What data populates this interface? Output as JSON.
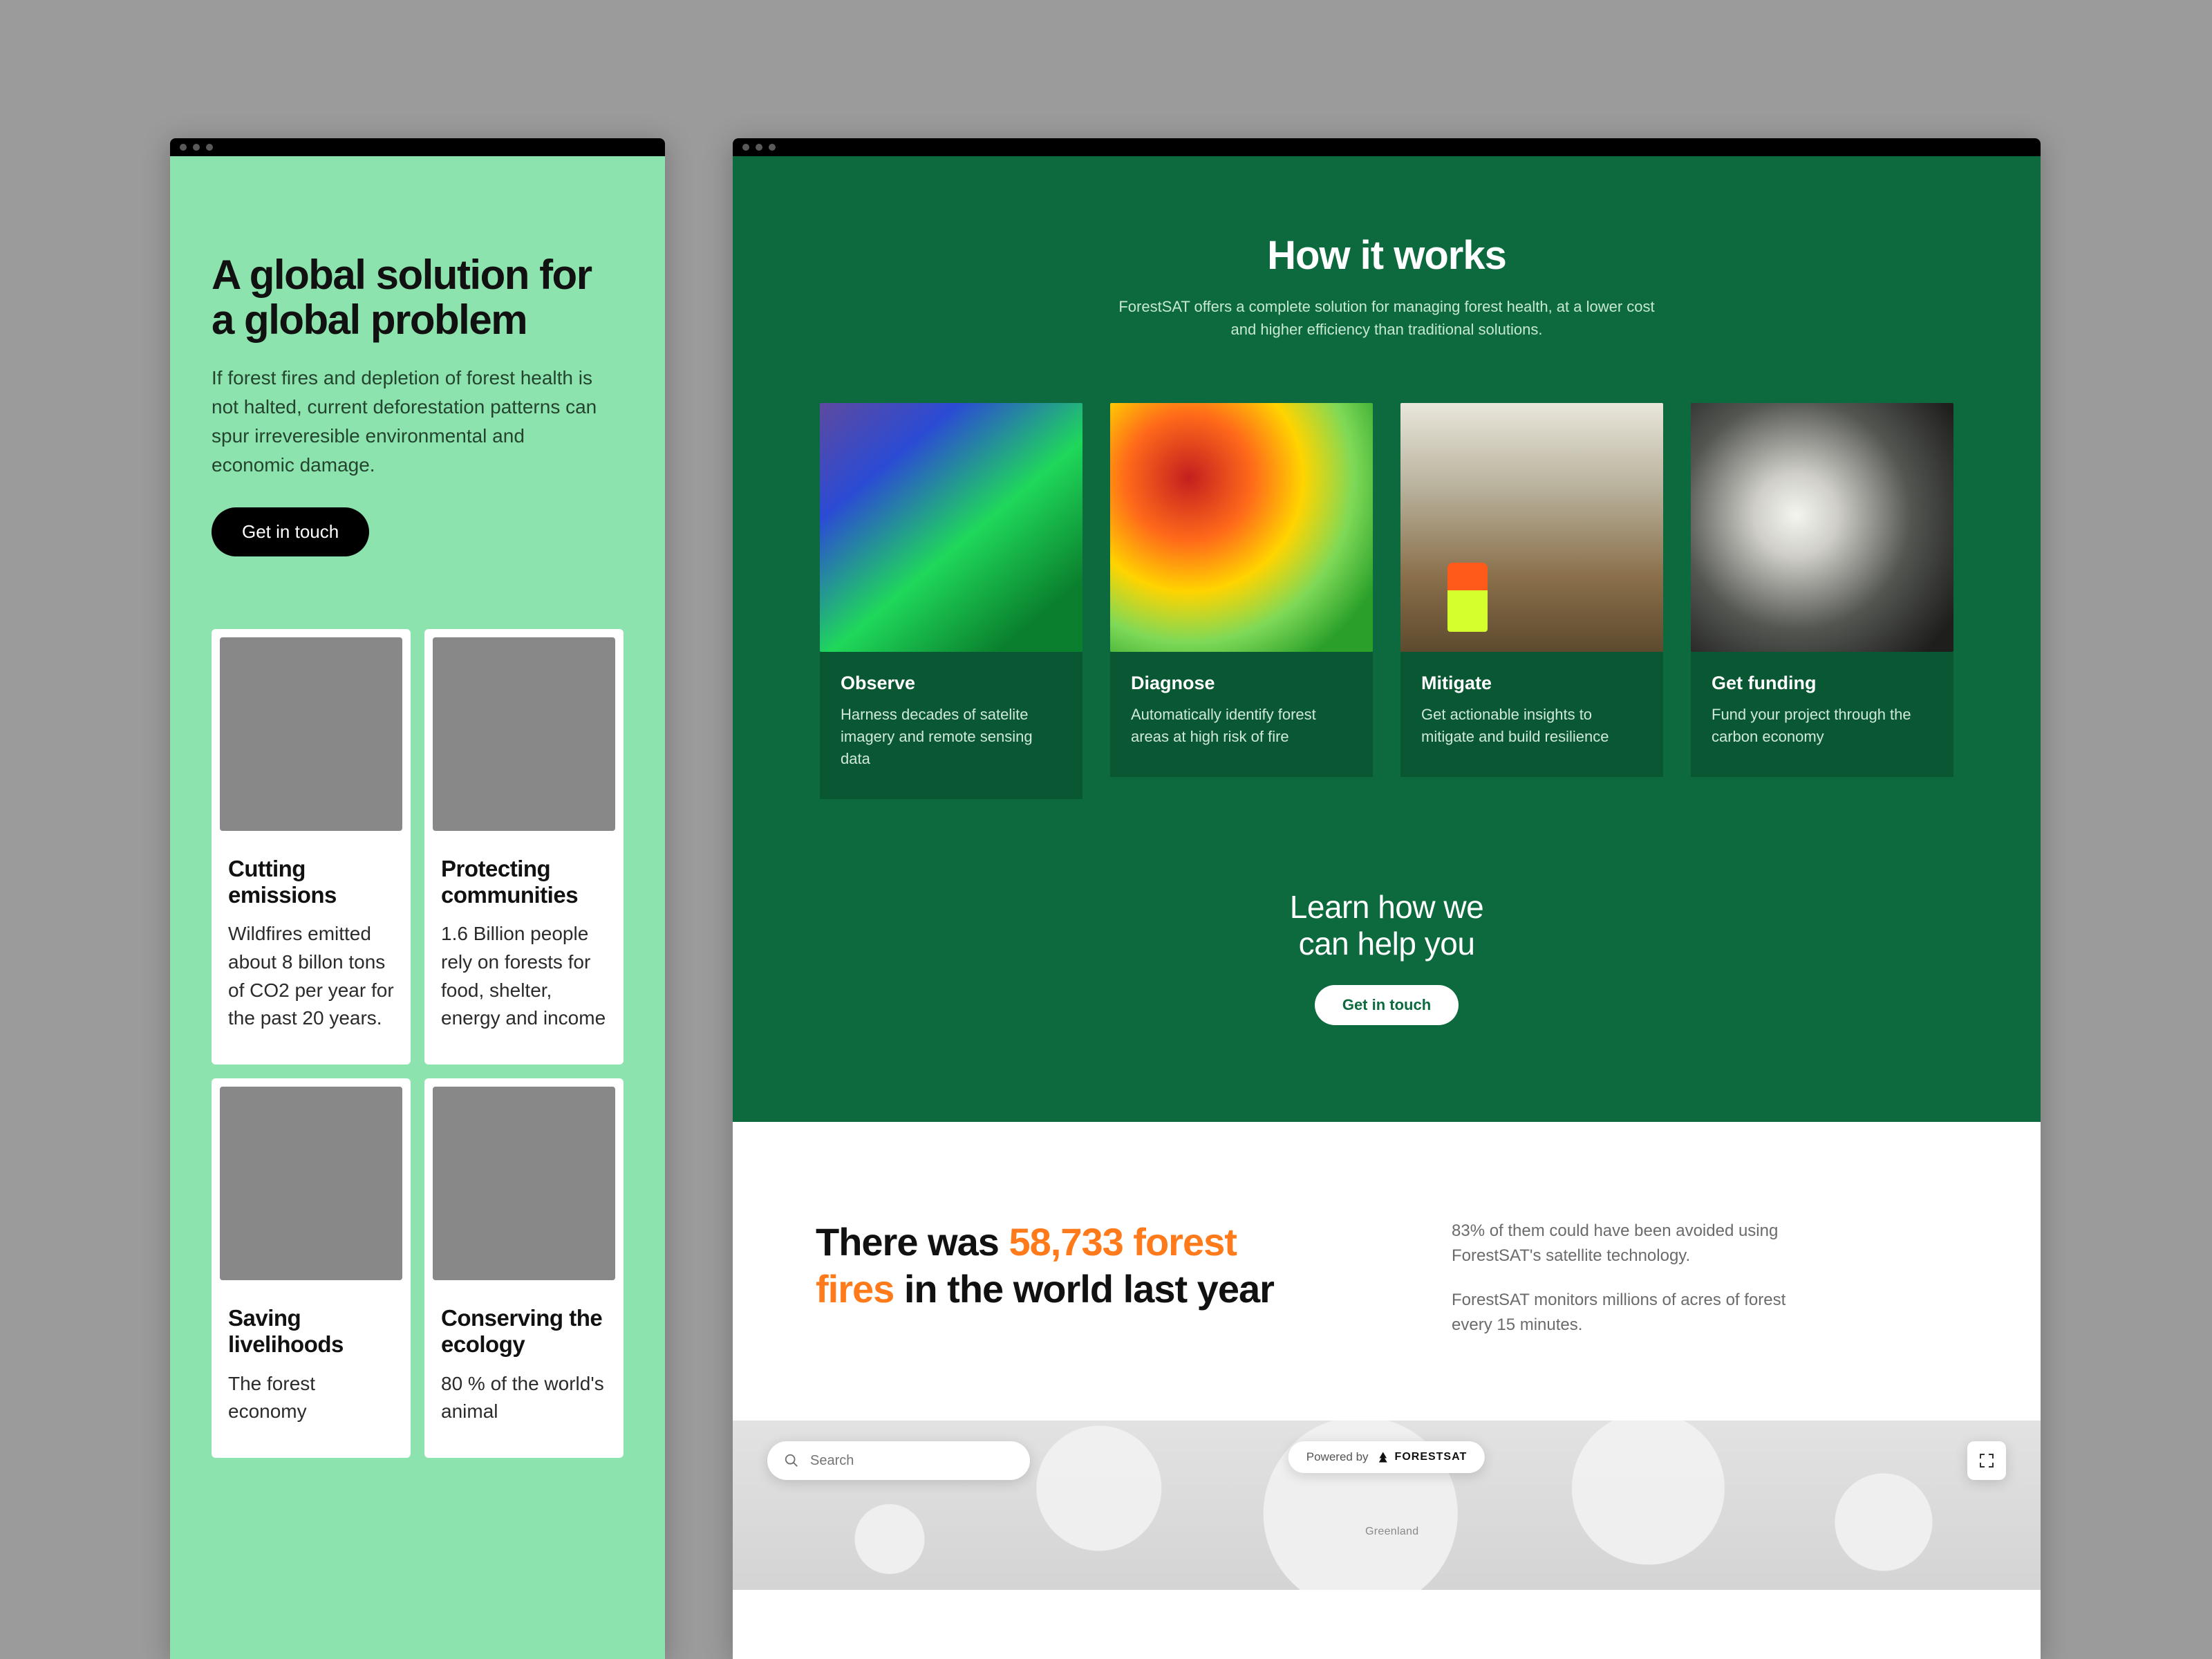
{
  "colors": {
    "mint": "#8de3ad",
    "forest": "#0c6a3e",
    "forest_dark": "#0a5733",
    "accent_orange": "#ff7a1a"
  },
  "mobile": {
    "hero_title": "A global solution for a global problem",
    "hero_body": "If forest fires and depletion of forest health is not halted, current deforestation patterns can spur irreveresible environmental and economic damage.",
    "cta_label": "Get in touch",
    "cards": [
      {
        "title": "Cutting emissions",
        "body": "Wildfires emitted about 8 billon tons of CO2 per year for the past 20 years.",
        "img": "img-forest-river"
      },
      {
        "title": "Protecting communities",
        "body": "1.6 Billion people rely on forests for food, shelter, energy and income",
        "img": "img-community"
      },
      {
        "title": "Saving livelihoods",
        "body": "The forest economy",
        "img": "img-fire"
      },
      {
        "title": "Conserving the ecology",
        "body": "80 % of the world's animal",
        "img": "img-deer"
      }
    ]
  },
  "desktop": {
    "hiw_title": "How it works",
    "hiw_sub": "ForestSAT offers a complete solution for managing forest health, at a lower cost and higher efficiency than traditional solutions.",
    "steps": [
      {
        "title": "Observe",
        "body": "Harness decades of satelite imagery and remote sensing data",
        "img": "img-sat"
      },
      {
        "title": "Diagnose",
        "body": "Automatically identify forest areas at high risk of fire",
        "img": "img-heat"
      },
      {
        "title": "Mitigate",
        "body": "Get actionable insights to mitigate and build resilience",
        "img": "img-worker"
      },
      {
        "title": "Get funding",
        "body": "Fund your project through the carbon economy",
        "img": "img-clouds"
      }
    ],
    "cta_heading_l1": "Learn how we",
    "cta_heading_l2": "can help you",
    "cta_label": "Get in touch",
    "stat_pre": "There was ",
    "stat_value": "58,733 forest fires",
    "stat_post": " in the world last year",
    "stat_side_1": "83% of them could have been avoided using ForestSAT's satellite technology.",
    "stat_side_2": "ForestSAT monitors millions of acres of forest every 15 minutes.",
    "map": {
      "search_placeholder": "Search",
      "powered_label": "Powered by",
      "brand": "FORESTSAT",
      "region_label": "Greenland"
    }
  }
}
